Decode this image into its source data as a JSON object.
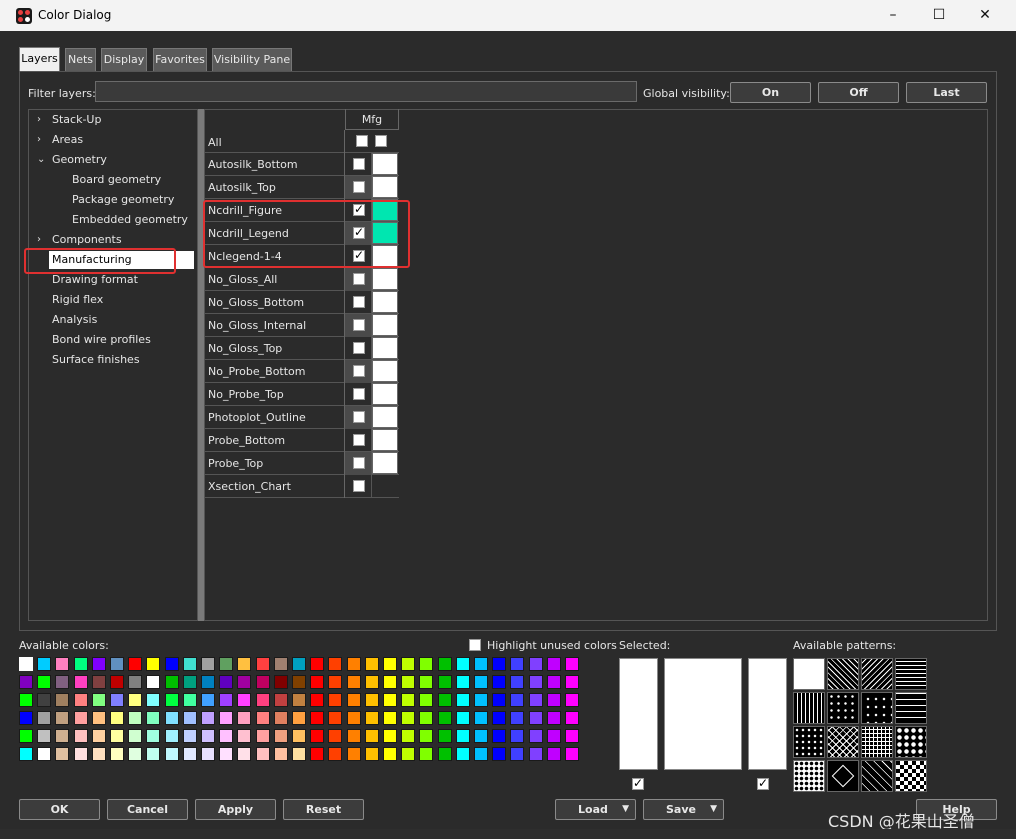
{
  "window": {
    "title": "Color Dialog",
    "minimize": "–",
    "maximize": "☐",
    "close": "✕"
  },
  "tabs": [
    {
      "label": "Layers",
      "active": true
    },
    {
      "label": "Nets"
    },
    {
      "label": "Display"
    },
    {
      "label": "Favorites"
    },
    {
      "label": "Visibility Pane"
    }
  ],
  "filter": {
    "label": "Filter layers:",
    "value": ""
  },
  "global_visibility": {
    "label": "Global visibility:",
    "on": "On",
    "off": "Off",
    "last": "Last"
  },
  "tree": [
    {
      "label": "Stack-Up",
      "chevron": "›"
    },
    {
      "label": "Areas",
      "chevron": "›"
    },
    {
      "label": "Geometry",
      "chevron": "⌄"
    },
    {
      "label": "Board geometry"
    },
    {
      "label": "Package geometry"
    },
    {
      "label": "Embedded geometry"
    },
    {
      "label": "Components",
      "chevron": "›"
    },
    {
      "label": "Manufacturing",
      "selected": true
    },
    {
      "label": "Drawing format"
    },
    {
      "label": "Rigid flex"
    },
    {
      "label": "Analysis"
    },
    {
      "label": "Bond wire profiles"
    },
    {
      "label": "Surface finishes"
    }
  ],
  "layers": {
    "column": "Mfg",
    "all_label": "All",
    "rows": [
      {
        "name": "Autosilk_Bottom",
        "checked": false,
        "color": "#ffffff"
      },
      {
        "name": "Autosilk_Top",
        "checked": false,
        "color": "#ffffff"
      },
      {
        "name": "Ncdrill_Figure",
        "checked": true,
        "color": "#00e6b0"
      },
      {
        "name": "Ncdrill_Legend",
        "checked": true,
        "color": "#00e6b0"
      },
      {
        "name": "Nclegend-1-4",
        "checked": true,
        "color": "#ffffff"
      },
      {
        "name": "No_Gloss_All",
        "checked": false,
        "color": "#ffffff"
      },
      {
        "name": "No_Gloss_Bottom",
        "checked": false,
        "color": "#ffffff"
      },
      {
        "name": "No_Gloss_Internal",
        "checked": false,
        "color": "#ffffff"
      },
      {
        "name": "No_Gloss_Top",
        "checked": false,
        "color": "#ffffff"
      },
      {
        "name": "No_Probe_Bottom",
        "checked": false,
        "color": "#ffffff"
      },
      {
        "name": "No_Probe_Top",
        "checked": false,
        "color": "#ffffff"
      },
      {
        "name": "Photoplot_Outline",
        "checked": false,
        "color": "#ffffff"
      },
      {
        "name": "Probe_Bottom",
        "checked": false,
        "color": "#ffffff"
      },
      {
        "name": "Probe_Top",
        "checked": false,
        "color": "#ffffff"
      },
      {
        "name": "Xsection_Chart",
        "checked": false,
        "color": null
      }
    ]
  },
  "colors": {
    "label": "Available colors:",
    "highlight_unused": "Highlight unused colors",
    "rows": [
      [
        "#ffffff",
        "#00ccff",
        "#ff80c0",
        "#00ff80",
        "#8000ff",
        "#6090c0",
        "#ff0000",
        "#ffff00",
        "#0000ff",
        "#40e0d0",
        "#a0a0a0",
        "#60a060",
        "#ffc040",
        "#ff4040",
        "#a08070",
        "#00a0c0",
        "#ff0000",
        "#ff4000",
        "#ff8000",
        "#ffc000",
        "#ffff00",
        "#c0ff00",
        "#80ff00",
        "#00c000",
        "#00ffff",
        "#00c0ff",
        "#0000ff",
        "#4040ff",
        "#8040ff",
        "#c000ff",
        "#ff00ff"
      ],
      [
        "#8000c0",
        "#00ff00",
        "#806080",
        "#ff40c0",
        "#804040",
        "#c00000",
        "#808080",
        "#ffffff",
        "#00c000",
        "#00a080",
        "#0080c0",
        "#6000c0",
        "#a000a0",
        "#c00060",
        "#800000",
        "#804000",
        "#ff0000",
        "#ff4000",
        "#ff8000",
        "#ffc000",
        "#ffff00",
        "#c0ff00",
        "#80ff00",
        "#00c000",
        "#00ffff",
        "#00c0ff",
        "#0000ff",
        "#4040ff",
        "#8040ff",
        "#c000ff",
        "#ff00ff"
      ],
      [
        "#00ff00",
        "#404040",
        "#a08060",
        "#ff8080",
        "#80ff80",
        "#8080ff",
        "#ffff80",
        "#80ffff",
        "#00ff40",
        "#40ffa0",
        "#40a0ff",
        "#a040ff",
        "#ff40ff",
        "#ff4080",
        "#c04040",
        "#c08040",
        "#ff0000",
        "#ff4000",
        "#ff8000",
        "#ffc000",
        "#ffff00",
        "#c0ff00",
        "#80ff00",
        "#00c000",
        "#00ffff",
        "#00c0ff",
        "#0000ff",
        "#4040ff",
        "#8040ff",
        "#c000ff",
        "#ff00ff"
      ],
      [
        "#0000ff",
        "#a0a0a0",
        "#c0a080",
        "#ffa0a0",
        "#ffc080",
        "#ffff80",
        "#c0ffc0",
        "#80ffc0",
        "#80e0ff",
        "#a0c0ff",
        "#c0a0ff",
        "#ffa0ff",
        "#ffa0c0",
        "#ff8080",
        "#e08060",
        "#ffa040",
        "#ff0000",
        "#ff4000",
        "#ff8000",
        "#ffc000",
        "#ffff00",
        "#c0ff00",
        "#80ff00",
        "#00c000",
        "#00ffff",
        "#00c0ff",
        "#0000ff",
        "#4040ff",
        "#8040ff",
        "#c000ff",
        "#ff00ff"
      ],
      [
        "#00ff00",
        "#c0c0c0",
        "#d0b090",
        "#ffc0c0",
        "#ffd0a0",
        "#ffffa0",
        "#d0ffd0",
        "#a0ffe0",
        "#a0f0ff",
        "#c0d0ff",
        "#d0c0ff",
        "#ffc0ff",
        "#ffc0d0",
        "#ffa0a0",
        "#f0a080",
        "#ffc060",
        "#ff0000",
        "#ff4000",
        "#ff8000",
        "#ffc000",
        "#ffff00",
        "#c0ff00",
        "#80ff00",
        "#00c000",
        "#00ffff",
        "#00c0ff",
        "#0000ff",
        "#4040ff",
        "#8040ff",
        "#c000ff",
        "#ff00ff"
      ],
      [
        "#00ffff",
        "#ffffff",
        "#e0c0a0",
        "#ffe0e0",
        "#ffe0c0",
        "#ffffc0",
        "#e0ffe0",
        "#c0fff0",
        "#c0f8ff",
        "#e0e8ff",
        "#e8e0ff",
        "#ffe0ff",
        "#ffe0e8",
        "#ffc0c0",
        "#ffc0a0",
        "#ffe0a0",
        "#ff0000",
        "#ff4000",
        "#ff8000",
        "#ffc000",
        "#ffff00",
        "#c0ff00",
        "#80ff00",
        "#00c000",
        "#00ffff",
        "#00c0ff",
        "#0000ff",
        "#4040ff",
        "#8040ff",
        "#c000ff",
        "#ff00ff"
      ]
    ]
  },
  "selected": {
    "label": "Selected:",
    "left_checked": true,
    "right_checked": true
  },
  "patterns": {
    "label": "Available patterns:"
  },
  "buttons": {
    "ok": "OK",
    "cancel": "Cancel",
    "apply": "Apply",
    "reset": "Reset",
    "load": "Load",
    "save": "Save",
    "help": "Help",
    "arrow": "▼"
  },
  "watermark": "CSDN @花果山圣僧"
}
